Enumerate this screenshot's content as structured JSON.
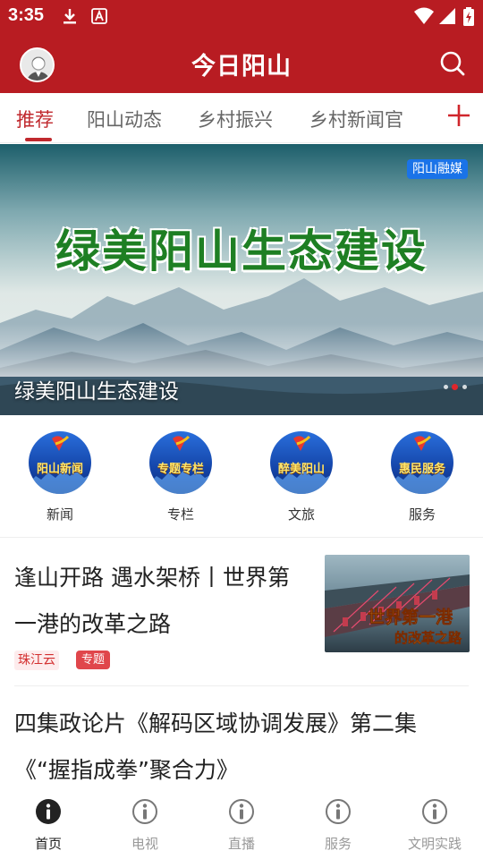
{
  "status_bar": {
    "time": "3:35"
  },
  "header": {
    "title": "今日阳山"
  },
  "tabs": [
    {
      "label": "推荐",
      "active": true
    },
    {
      "label": "阳山动态"
    },
    {
      "label": "乡村振兴"
    },
    {
      "label": "乡村新闻官"
    }
  ],
  "banner": {
    "art_title": "绿美阳山生态建设",
    "badge": "阳山融媒",
    "caption": "绿美阳山生态建设",
    "slide_count": 3,
    "active_slide": 2
  },
  "entries": [
    {
      "icon_text": "阳山新闻",
      "label": "新闻"
    },
    {
      "icon_text": "专题专栏",
      "label": "专栏"
    },
    {
      "icon_text": "醉美阳山",
      "label": "文旅"
    },
    {
      "icon_text": "惠民服务",
      "label": "服务"
    }
  ],
  "news": [
    {
      "title": "逢山开路 遇水架桥丨世界第一港的改革之路",
      "source": "珠江云",
      "tag": "专题",
      "thumb_text_line1": "世界第一港",
      "thumb_text_line2": "的改革之路"
    },
    {
      "title": "四集政论片《解码区域协调发展》第二集《“握指成拳”聚合力》"
    }
  ],
  "bottom_nav": [
    {
      "label": "首页",
      "icon": "info-icon",
      "active": true
    },
    {
      "label": "电视",
      "icon": "info-icon"
    },
    {
      "label": "直播",
      "icon": "info-icon"
    },
    {
      "label": "服务",
      "icon": "info-icon"
    },
    {
      "label": "文明实践",
      "icon": "info-icon"
    }
  ],
  "colors": {
    "brand_red": "#b81c22",
    "tab_active": "#c0282d",
    "badge_blue": "#1a73e8",
    "tag_red": "#e0464b"
  }
}
